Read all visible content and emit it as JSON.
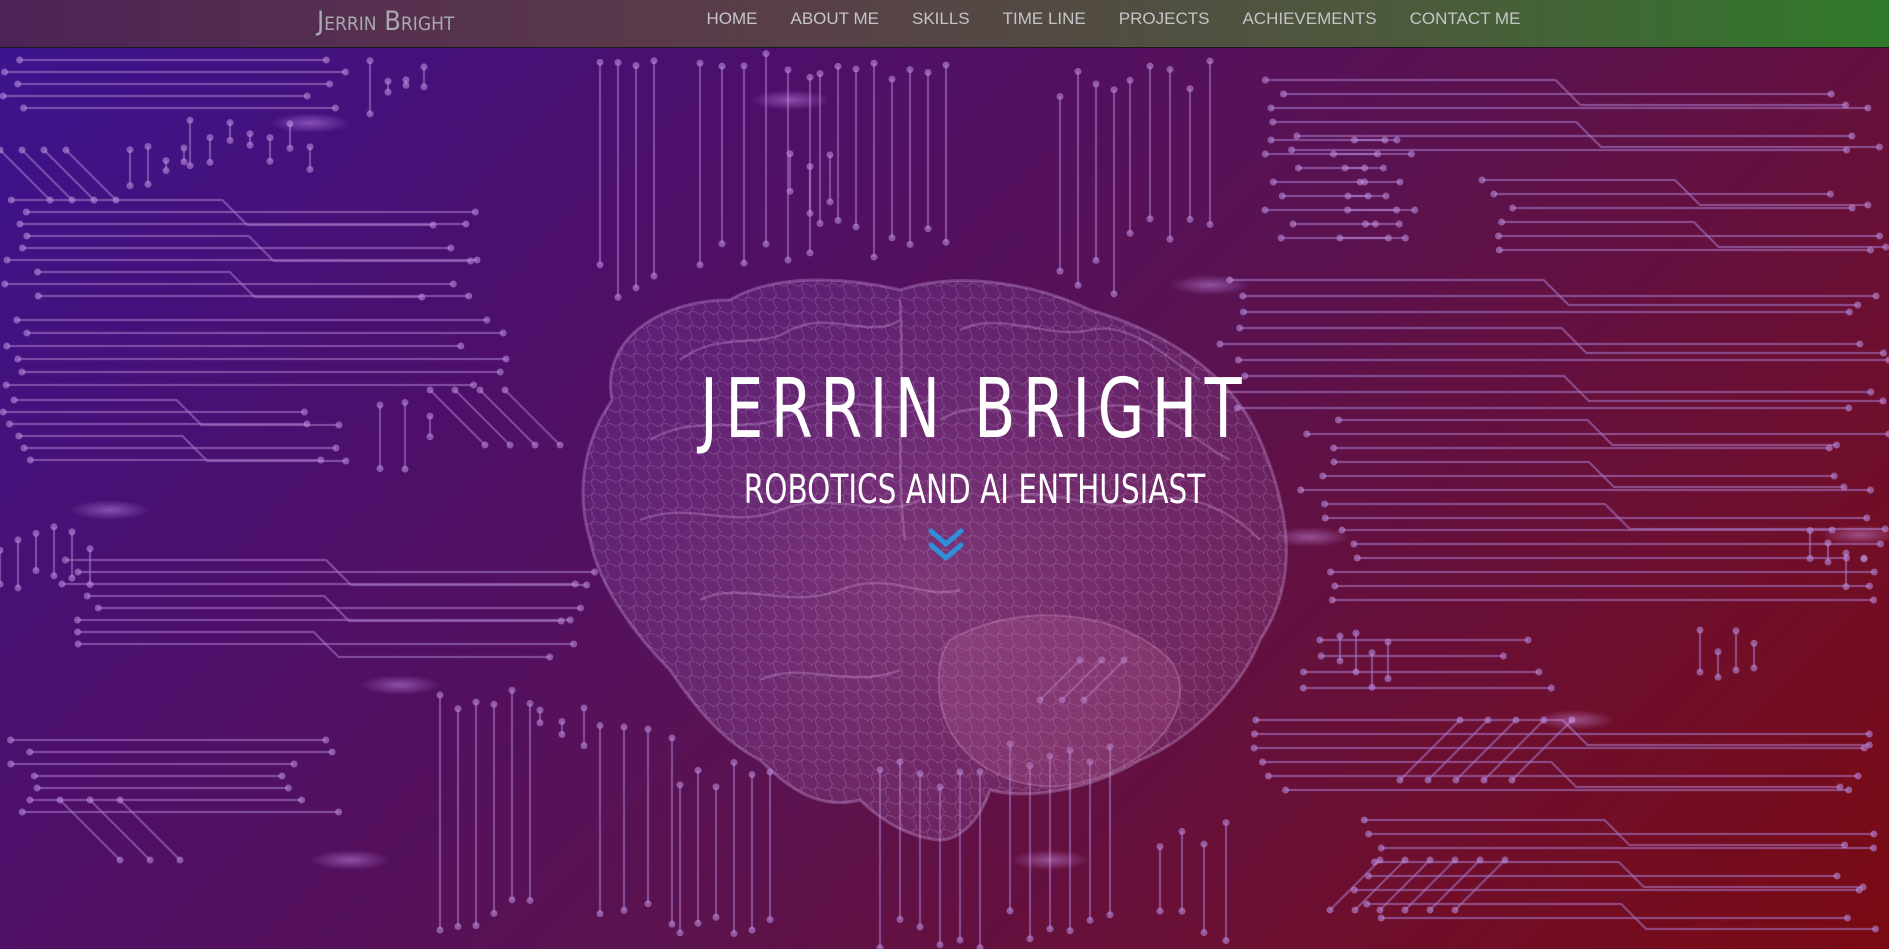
{
  "navbar": {
    "brand": "Jerrin Bright",
    "items": [
      {
        "label": "HOME"
      },
      {
        "label": "ABOUT ME"
      },
      {
        "label": "SKILLS"
      },
      {
        "label": "TIME LINE"
      },
      {
        "label": "PROJECTS"
      },
      {
        "label": "ACHIEVEMENTS"
      },
      {
        "label": "CONTACT ME"
      }
    ]
  },
  "hero": {
    "title": "JERRIN BRIGHT",
    "subtitle": "ROBOTICS AND AI ENTHUSIAST",
    "scroll_icon": "double-chevron-down-icon"
  },
  "colors": {
    "scroll_icon": "#2f8fd8",
    "nav_text": "#c5c5c8",
    "hero_text": "#ffffff"
  }
}
